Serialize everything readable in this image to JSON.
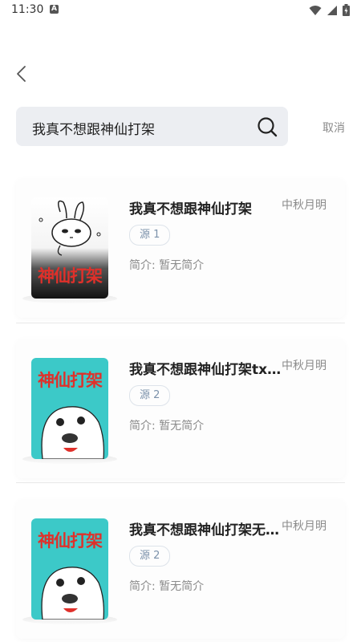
{
  "status": {
    "time": "11:30",
    "notification_letter": "A"
  },
  "search": {
    "query": "我真不想跟神仙打架",
    "cancel_label": "取消"
  },
  "results": [
    {
      "title": "我真不想跟神仙打架",
      "author": "中秋月明",
      "source": "源 1",
      "intro": "简介: 暂无简介",
      "cover_text": "神仙打架",
      "cover_style": "dark"
    },
    {
      "title": "我真不想跟神仙打架txt…",
      "author": "中秋月明",
      "source": "源 2",
      "intro": "简介: 暂无简介",
      "cover_text": "神仙打架",
      "cover_style": "teal"
    },
    {
      "title": "我真不想跟神仙打架无…",
      "author": "中秋月明",
      "source": "源 2",
      "intro": "简介: 暂无简介",
      "cover_text": "神仙打架",
      "cover_style": "teal"
    }
  ],
  "colors": {
    "accent": "#7c92ab",
    "search_bg": "#eceef2",
    "cover_title_red": "#e0302a",
    "cover_teal": "#3cc9c8"
  }
}
